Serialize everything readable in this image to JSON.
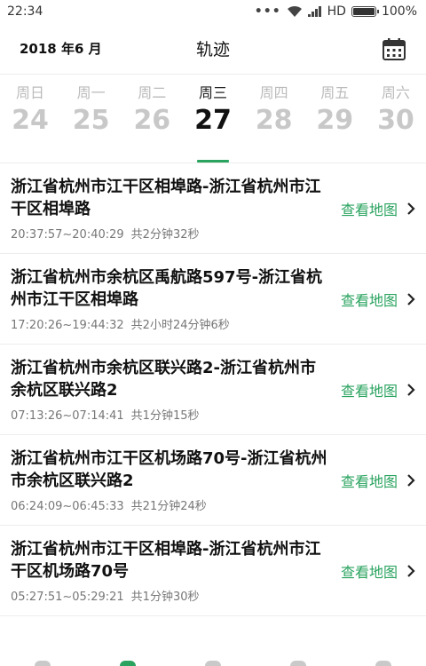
{
  "status_bar": {
    "time": "22:34",
    "dots": "•••",
    "network": "HD",
    "battery": "100%",
    "battery_level": 1.0
  },
  "header": {
    "date": "2018 年6 月",
    "title": "轨迹"
  },
  "week": [
    {
      "label": "周日",
      "num": "24"
    },
    {
      "label": "周一",
      "num": "25"
    },
    {
      "label": "周二",
      "num": "26"
    },
    {
      "label": "周三",
      "num": "27",
      "active": true
    },
    {
      "label": "周四",
      "num": "28"
    },
    {
      "label": "周五",
      "num": "29"
    },
    {
      "label": "周六",
      "num": "30"
    }
  ],
  "view_map_label": "查看地图",
  "tracks": [
    {
      "route": "浙江省杭州市江干区相埠路-浙江省杭州市江干区相埠路",
      "time": "20:37:57~20:40:29",
      "duration": "共2分钟32秒"
    },
    {
      "route": "浙江省杭州市余杭区禹航路597号-浙江省杭州市江干区相埠路",
      "time": "17:20:26~19:44:32",
      "duration": "共2小时24分钟6秒"
    },
    {
      "route": "浙江省杭州市余杭区联兴路2-浙江省杭州市余杭区联兴路2",
      "time": "07:13:26~07:14:41",
      "duration": "共1分钟15秒"
    },
    {
      "route": "浙江省杭州市江干区机场路70号-浙江省杭州市余杭区联兴路2",
      "time": "06:24:09~06:45:33",
      "duration": "共21分钟24秒"
    },
    {
      "route": "浙江省杭州市江干区相埠路-浙江省杭州市江干区机场路70号",
      "time": "05:27:51~05:29:21",
      "duration": "共1分钟30秒"
    }
  ],
  "colors": {
    "accent": "#2aa35f"
  }
}
